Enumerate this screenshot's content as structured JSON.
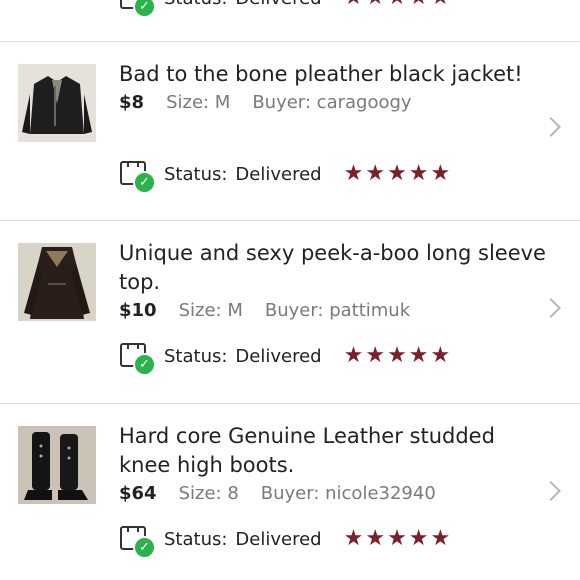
{
  "status_label": "Status:",
  "status_value": "Delivered",
  "rating_stars": 5,
  "star_color": "#7a1f2b",
  "check_color": "#2bb24c",
  "items": [
    {
      "title": "Bad to the bone pleather black jacket!",
      "price": "$8",
      "size": "Size: M",
      "buyer": "Buyer: caragoogy"
    },
    {
      "title": "Unique and sexy peek-a-boo long sleeve top.",
      "price": "$10",
      "size": "Size: M",
      "buyer": "Buyer: pattimuk"
    },
    {
      "title": "Hard core Genuine Leather studded knee high boots.",
      "price": "$64",
      "size": "Size: 8",
      "buyer": "Buyer: nicole32940"
    }
  ]
}
